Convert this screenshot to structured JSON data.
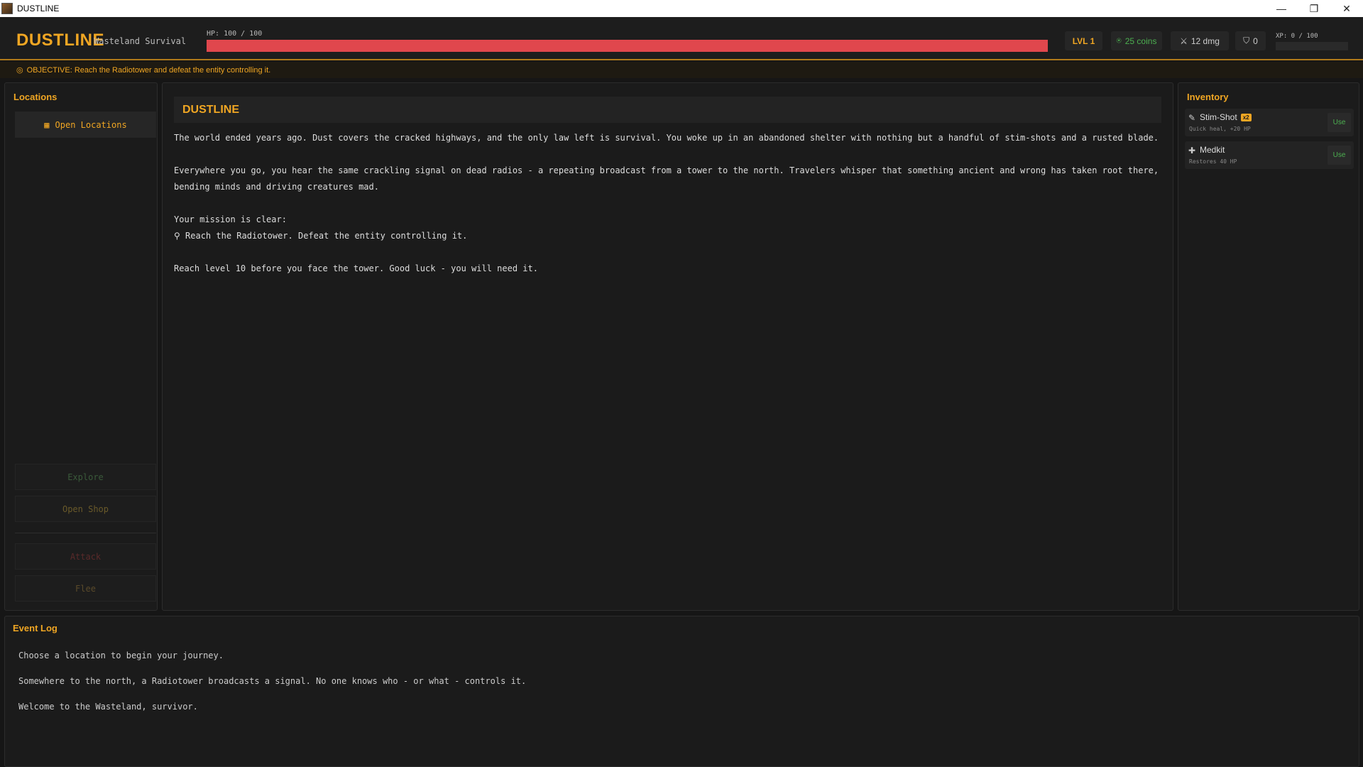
{
  "window": {
    "title": "DUSTLINE",
    "min": "—",
    "max": "❐",
    "close": "✕"
  },
  "header": {
    "brand": "DUSTLINE",
    "subtitle": "Wasteland Survival",
    "hp_label": "HP: 100 / 100",
    "hp_fraction": 1.0,
    "level": "LVL 1",
    "coins": "25 coins",
    "damage": "12 dmg",
    "defense": "0",
    "xp_label": "XP: 0 / 100",
    "xp_fraction": 0.0
  },
  "objective": "OBJECTIVE: Reach the Radiotower and defeat the entity controlling it.",
  "locations": {
    "title": "Locations",
    "open_locations": "Open Locations",
    "explore": "Explore",
    "open_shop": "Open Shop",
    "attack": "Attack",
    "flee": "Flee"
  },
  "story": {
    "title": "DUSTLINE",
    "p1": "The world ended years ago. Dust covers the cracked highways, and the only law left is survival. You woke up in an abandoned shelter with nothing but a handful of stim-shots and a rusted blade.",
    "p2": "Everywhere you go, you hear the same crackling signal on dead radios - a repeating broadcast from a tower to the north. Travelers whisper that something ancient and wrong has taken root there, bending minds and driving creatures mad.",
    "p3": "Your mission is clear:",
    "p4": "Reach the Radiotower. Defeat the entity controlling it.",
    "p5": "Reach level 10 before you face the tower. Good luck - you will need it."
  },
  "inventory": {
    "title": "Inventory",
    "items": [
      {
        "name": "Stim-Shot",
        "qty": "x2",
        "desc": "Quick heal, +20 HP",
        "use": "Use"
      },
      {
        "name": "Medkit",
        "desc": "Restores 40 HP",
        "use": "Use"
      }
    ]
  },
  "event_log": {
    "title": "Event Log",
    "entries": [
      "Choose a location to begin your journey.",
      "Somewhere to the north, a Radiotower broadcasts a signal. No one knows who - or what - controls it.",
      "Welcome to the Wasteland, survivor."
    ]
  },
  "colors": {
    "accent": "#f0a623",
    "hp": "#e0474d",
    "coins": "#4caf50"
  }
}
